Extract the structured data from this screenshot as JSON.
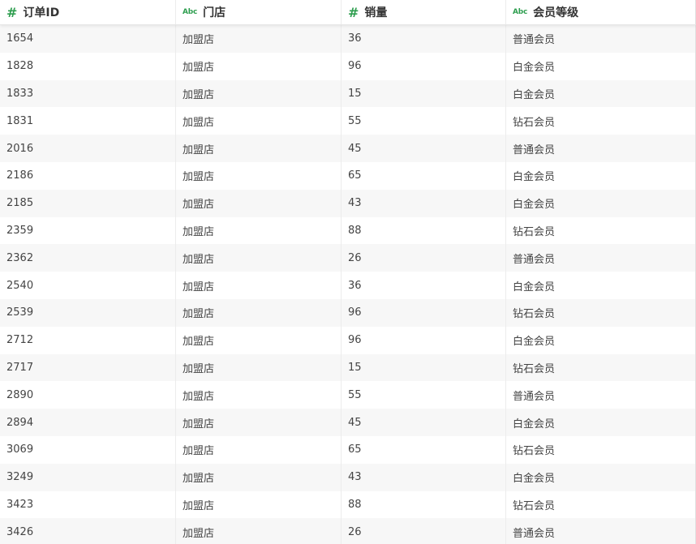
{
  "columns": [
    {
      "label": "订单ID",
      "type_icon": "#",
      "type_icon_name": "number-type-icon"
    },
    {
      "label": "门店",
      "type_icon": "Abc",
      "type_icon_name": "text-type-icon"
    },
    {
      "label": "销量",
      "type_icon": "#",
      "type_icon_name": "number-type-icon"
    },
    {
      "label": "会员等级",
      "type_icon": "Abc",
      "type_icon_name": "text-type-icon"
    }
  ],
  "rows": [
    [
      "1654",
      "加盟店",
      "36",
      "普通会员"
    ],
    [
      "1828",
      "加盟店",
      "96",
      "白金会员"
    ],
    [
      "1833",
      "加盟店",
      "15",
      "白金会员"
    ],
    [
      "1831",
      "加盟店",
      "55",
      "钻石会员"
    ],
    [
      "2016",
      "加盟店",
      "45",
      "普通会员"
    ],
    [
      "2186",
      "加盟店",
      "65",
      "白金会员"
    ],
    [
      "2185",
      "加盟店",
      "43",
      "白金会员"
    ],
    [
      "2359",
      "加盟店",
      "88",
      "钻石会员"
    ],
    [
      "2362",
      "加盟店",
      "26",
      "普通会员"
    ],
    [
      "2540",
      "加盟店",
      "36",
      "白金会员"
    ],
    [
      "2539",
      "加盟店",
      "96",
      "钻石会员"
    ],
    [
      "2712",
      "加盟店",
      "96",
      "白金会员"
    ],
    [
      "2717",
      "加盟店",
      "15",
      "钻石会员"
    ],
    [
      "2890",
      "加盟店",
      "55",
      "普通会员"
    ],
    [
      "2894",
      "加盟店",
      "45",
      "白金会员"
    ],
    [
      "3069",
      "加盟店",
      "65",
      "钻石会员"
    ],
    [
      "3249",
      "加盟店",
      "43",
      "白金会员"
    ],
    [
      "3423",
      "加盟店",
      "88",
      "钻石会员"
    ],
    [
      "3426",
      "加盟店",
      "26",
      "普通会员"
    ]
  ],
  "colors": {
    "type_icon": "#2e9e4f",
    "row_stripe": "#f7f7f7",
    "cell_text": "#444444",
    "header_text": "#333333"
  }
}
